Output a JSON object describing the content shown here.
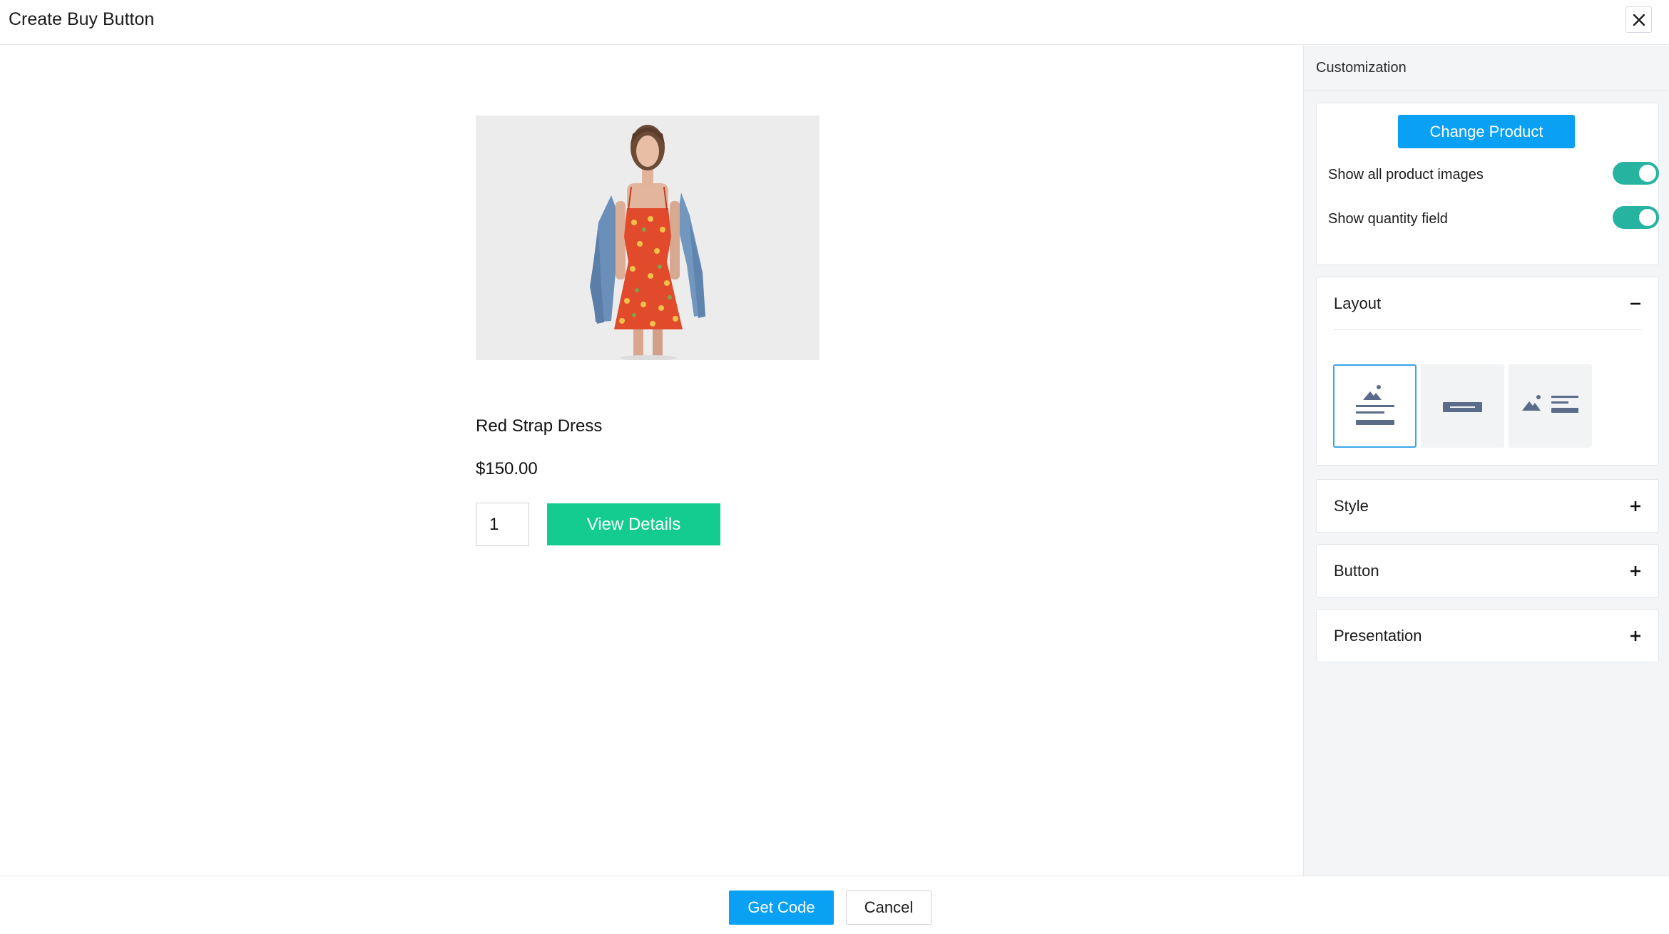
{
  "header": {
    "title": "Create Buy Button",
    "close_icon": "close-icon"
  },
  "preview": {
    "product": {
      "name": "Red Strap Dress",
      "price": "$150.00",
      "quantity": "1",
      "action_label": "View Details",
      "image": "product-photo"
    }
  },
  "sidebar": {
    "title": "Customization",
    "change_product_label": "Change Product",
    "toggles": [
      {
        "label": "Show all product images",
        "on": true
      },
      {
        "label": "Show quantity field",
        "on": true
      }
    ],
    "sections": {
      "layout": {
        "title": "Layout",
        "expanded": true,
        "icon": "minus-icon"
      },
      "style": {
        "title": "Style",
        "expanded": false,
        "icon": "plus-icon"
      },
      "button": {
        "title": "Button",
        "expanded": false,
        "icon": "plus-icon"
      },
      "presentation": {
        "title": "Presentation",
        "expanded": false,
        "icon": "plus-icon"
      }
    },
    "layout_options": [
      {
        "name": "image-above-details-layout-icon",
        "selected": true
      },
      {
        "name": "button-only-layout-icon",
        "selected": false
      },
      {
        "name": "image-beside-details-layout-icon",
        "selected": false
      }
    ]
  },
  "footer": {
    "get_code_label": "Get Code",
    "cancel_label": "Cancel"
  },
  "colors": {
    "primary_blue": "#0aa0f3",
    "action_green": "#14cc8f",
    "toggle_teal": "#26b3a0",
    "selected_border": "#3ca3ec",
    "icon_slate": "#5b6b8a"
  }
}
